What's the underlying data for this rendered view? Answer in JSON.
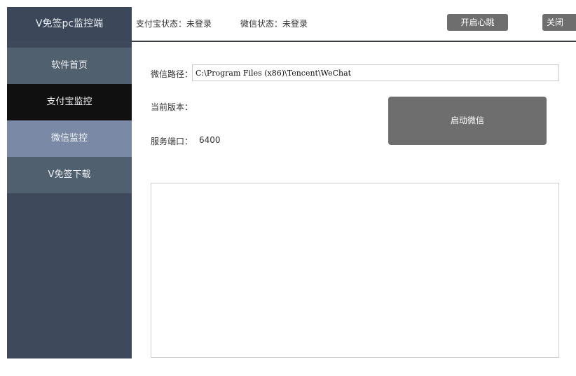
{
  "sidebar": {
    "brand": "V免签pc监控端",
    "items": [
      {
        "label": "软件首页"
      },
      {
        "label": "支付宝监控"
      },
      {
        "label": "微信监控"
      },
      {
        "label": "V免签下载"
      }
    ]
  },
  "topbar": {
    "alipay_status": "支付宝状态：未登录",
    "wechat_status": "微信状态：未登录",
    "heartbeat_button": "开启心跳",
    "close_button": "关闭"
  },
  "wechat_panel": {
    "path_label": "微信路径：",
    "path_value": "C:\\Program Files (x86)\\Tencent\\WeChat",
    "version_label": "当前版本：",
    "version_value": "",
    "port_label": "服务端口：",
    "port_value": "6400",
    "launch_button": "启动微信"
  },
  "colors": {
    "sidebar_bg": "#3e4a5b",
    "active_item_bg": "#101010",
    "hover_item_bg": "#7989a6",
    "button_bg": "#6e6e6e"
  }
}
